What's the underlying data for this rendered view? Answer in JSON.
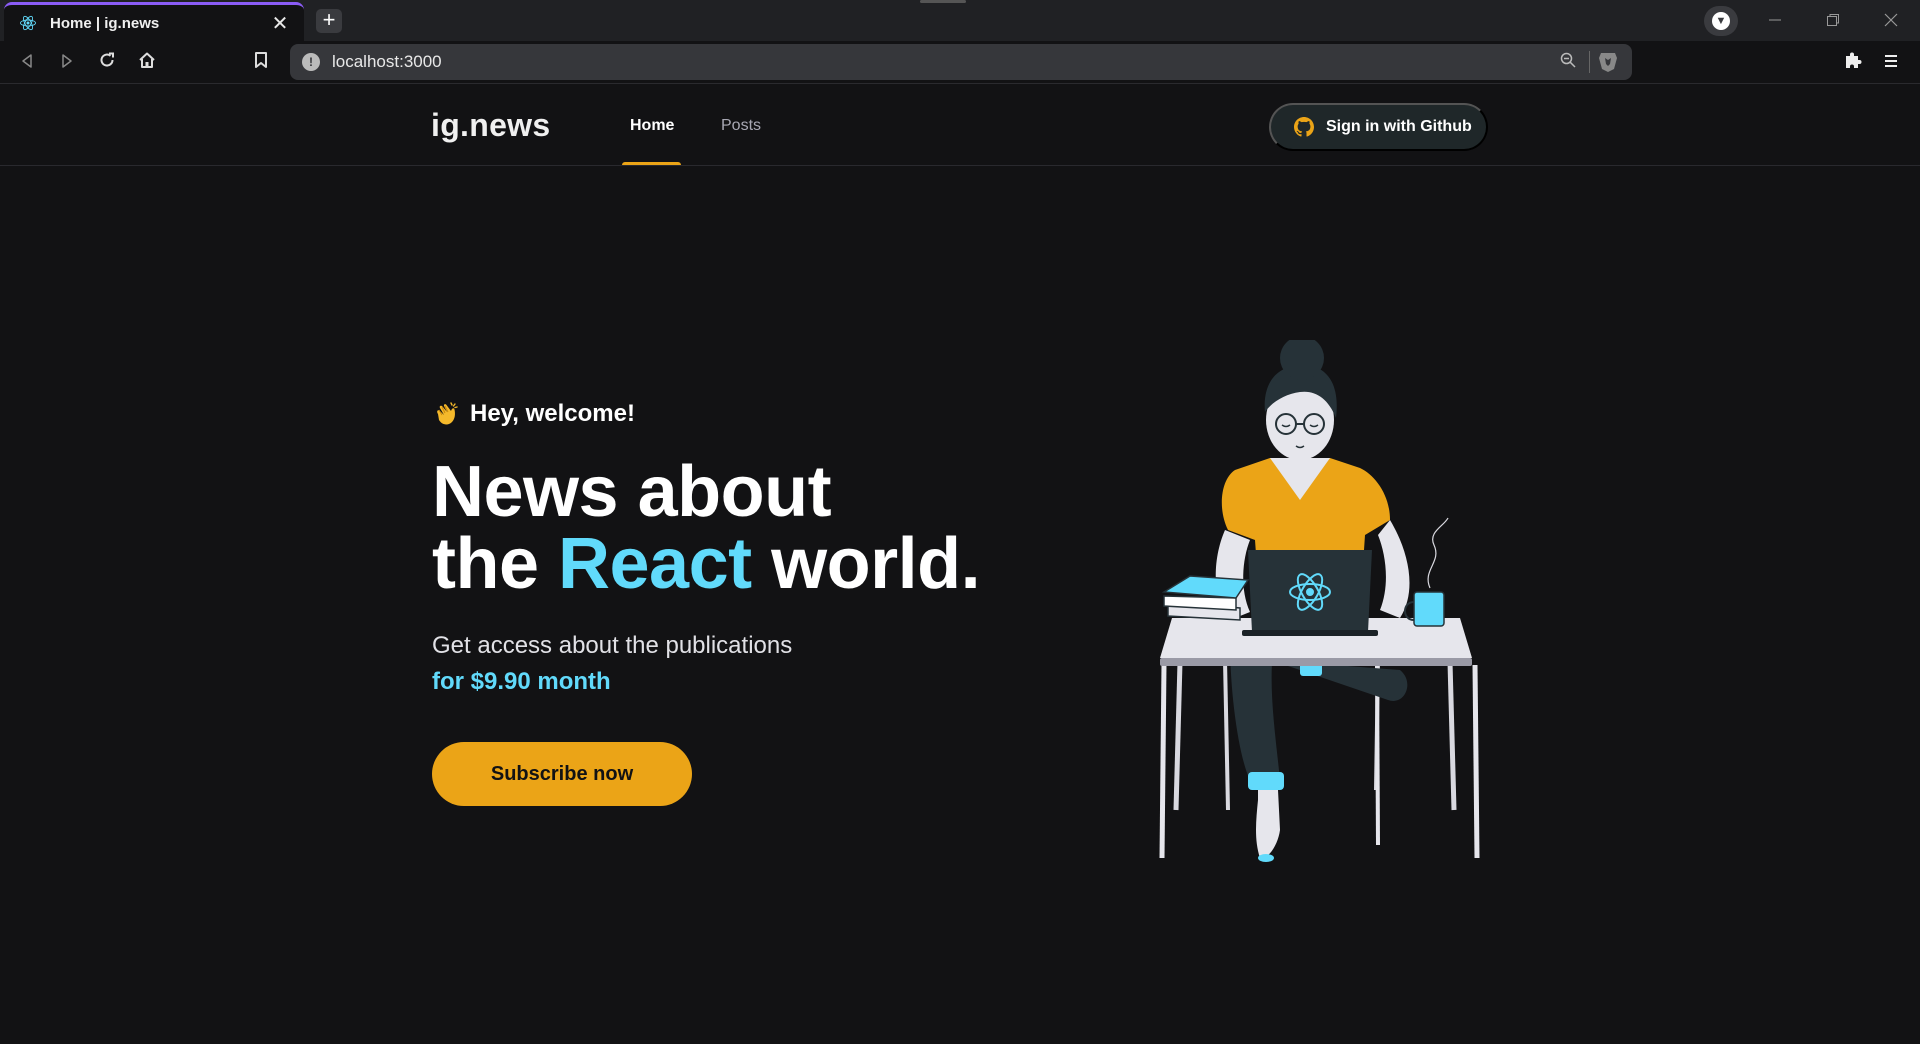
{
  "browser": {
    "tab_title": "Home | ig.news",
    "tab_close_glyph": "✕",
    "new_tab_glyph": "+",
    "url": "localhost:3000",
    "icons": {
      "favicon": "react-icon",
      "back": "back-icon",
      "forward": "forward-icon",
      "reload": "reload-icon",
      "home": "home-icon",
      "bookmark": "bookmark-icon",
      "site_info": "info-icon",
      "zoom": "zoom-out-icon",
      "brave_shield": "brave-shield-icon",
      "extensions": "puzzle-icon",
      "menu": "hamburger-icon"
    }
  },
  "header": {
    "logo": "ig.news",
    "nav": [
      {
        "label": "Home",
        "active": true
      },
      {
        "label": "Posts",
        "active": false
      }
    ],
    "sign_in_label": "Sign in with Github"
  },
  "hero": {
    "welcome": "Hey, welcome!",
    "headline_line1": "News about",
    "headline_line2_pre": "the",
    "headline_highlight": "React",
    "headline_line2_post": "world.",
    "subtitle": "Get access about the publications",
    "price": "for $9.90 month",
    "cta_label": "Subscribe now"
  },
  "colors": {
    "background": "#121214",
    "accent_yellow": "#eba417",
    "accent_cyan": "#61dafb",
    "header_button_bg": "#1f2729"
  }
}
